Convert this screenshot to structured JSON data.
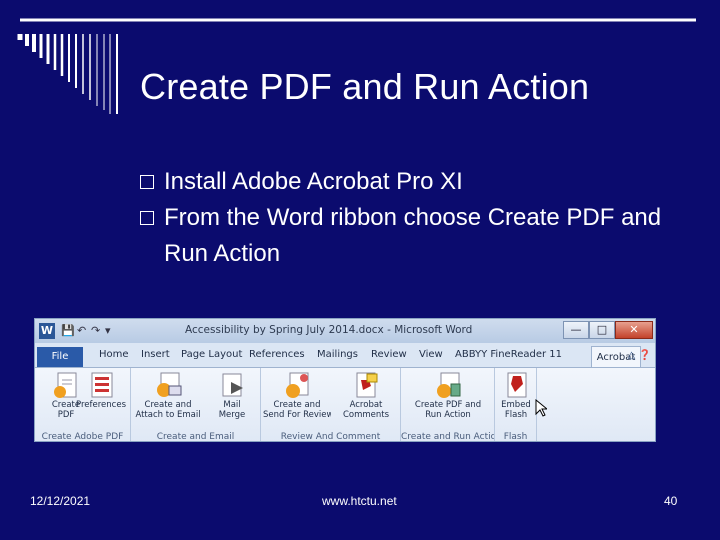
{
  "slide": {
    "title": "Create PDF and Run Action",
    "bullets": [
      "Install Adobe Acrobat Pro XI",
      "From the Word ribbon choose Create PDF and Run Action"
    ],
    "footer": {
      "date": "12/12/2021",
      "site": "www.htctu.net",
      "page": "40"
    }
  },
  "word": {
    "window_title": "Accessibility by Spring July 2014.docx - Microsoft Word",
    "file_tab": "File",
    "tabs": [
      "Home",
      "Insert",
      "Page Layout",
      "References",
      "Mailings",
      "Review",
      "View",
      "ABBYY FineReader 11"
    ],
    "active_tab": "Acrobat",
    "groups": [
      {
        "label": "Create Adobe PDF",
        "buttons": [
          {
            "line1": "Create",
            "line2": "PDF"
          },
          {
            "line1": "Preferences",
            "line2": ""
          }
        ]
      },
      {
        "label": "Create and Email",
        "buttons": [
          {
            "line1": "Create and",
            "line2": "Attach to Email"
          },
          {
            "line1": "Mail",
            "line2": "Merge"
          }
        ]
      },
      {
        "label": "Review And Comment",
        "buttons": [
          {
            "line1": "Create and",
            "line2": "Send For Review"
          },
          {
            "line1": "Acrobat",
            "line2": "Comments"
          }
        ]
      },
      {
        "label": "Create and Run Action",
        "buttons": [
          {
            "line1": "Create PDF and",
            "line2": "Run Action"
          }
        ]
      },
      {
        "label": "Flash",
        "buttons": [
          {
            "line1": "Embed",
            "line2": "Flash"
          }
        ]
      }
    ],
    "colors": {
      "accent": "#2a5aa8",
      "pdf_red": "#c0201c"
    }
  }
}
